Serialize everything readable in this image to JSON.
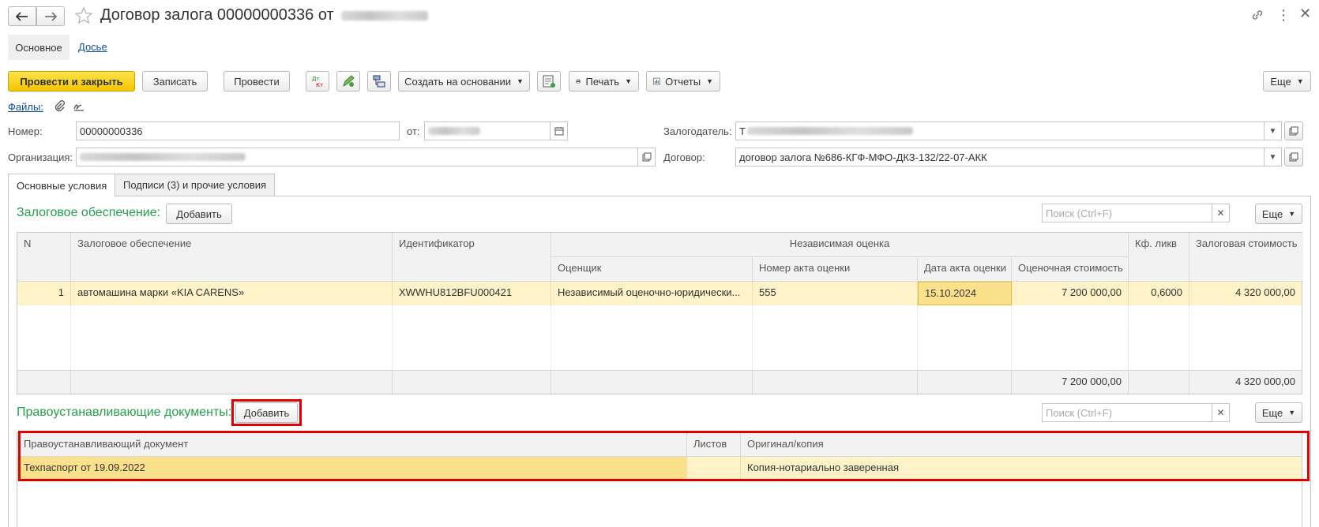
{
  "window": {
    "title": "Договор залога 00000000336 от",
    "nav_back_icon": "arrow-left-icon",
    "nav_forward_icon": "arrow-right-icon",
    "favorite_icon": "star-icon",
    "link_icon": "link-icon",
    "more_icon": "kebab-icon",
    "close_icon": "close-icon"
  },
  "view_tabs": {
    "main": "Основное",
    "dossier": "Досье"
  },
  "toolbar": {
    "post_close": "Провести и закрыть",
    "save": "Записать",
    "post": "Провести",
    "create_based": "Создать на основании",
    "print": "Печать",
    "reports": "Отчеты",
    "more": "Еще"
  },
  "files": {
    "label": "Файлы:"
  },
  "fields": {
    "number_label": "Номер:",
    "number_value": "00000000336",
    "date_label": "от:",
    "pledger_label": "Залогодатель:",
    "pledger_value": "Т",
    "org_label": "Организация:",
    "contract_label": "Договор:",
    "contract_value": "договор залога №686-КГФ-МФО-ДКЗ-132/22-07-АКК"
  },
  "form_tabs": {
    "main_conditions": "Основные условия",
    "signatures": "Подписи (3) и прочие условия"
  },
  "collateral": {
    "title": "Залоговое обеспечение:",
    "add": "Добавить",
    "search_placeholder": "Поиск (Ctrl+F)",
    "more": "Еще",
    "headers": {
      "n": "N",
      "collateral": "Залоговое обеспечение",
      "identifier": "Идентификатор",
      "independent": "Независимая оценка",
      "appraiser": "Оценщик",
      "act_number": "Номер акта оценки",
      "act_date": "Дата акта оценки",
      "appraised_value": "Оценочная стоимость",
      "liquidity": "Кф. ликв",
      "pledge_value": "Залоговая стоимость"
    },
    "rows": [
      {
        "n": "1",
        "collateral": "автомашина марки «KIA CARENS»",
        "identifier": "XWWHU812BFU000421",
        "appraiser": "Независимый оценочно-юридически...",
        "act_number": "555",
        "act_date": "15.10.2024",
        "appraised_value": "7 200 000,00",
        "liquidity": "0,6000",
        "pledge_value": "4 320 000,00"
      }
    ],
    "totals": {
      "appraised_value": "7 200 000,00",
      "pledge_value": "4 320 000,00"
    }
  },
  "title_docs": {
    "title": "Правоустанавливающие документы:",
    "add": "Добавить",
    "search_placeholder": "Поиск (Ctrl+F)",
    "more": "Еще",
    "headers": {
      "document": "Правоустанавливающий документ",
      "sheets": "Листов",
      "original": "Оригинал/копия"
    },
    "rows": [
      {
        "document": "Техпаспорт от 19.09.2022",
        "sheets": "",
        "original": "Копия-нотариально заверенная"
      }
    ]
  },
  "colors": {
    "highlight": "#e00000",
    "row_selected": "#fdebb0",
    "primary_button": "#f4c400",
    "section_title": "#24a04a"
  }
}
